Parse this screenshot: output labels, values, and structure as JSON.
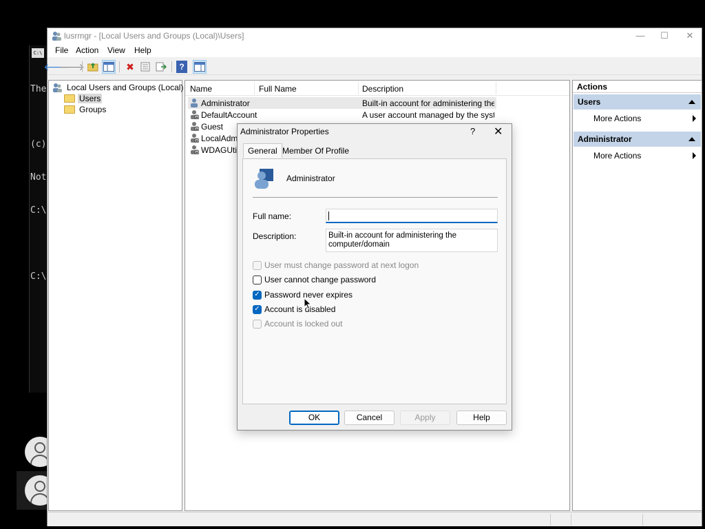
{
  "console": {
    "lines": [
      "The",
      "",
      "(c)",
      "Not",
      "C:\\",
      "",
      "C:\\"
    ],
    "icon_text": "C:\\"
  },
  "window": {
    "title": "lusrmgr - [Local Users and Groups (Local)\\Users]",
    "controls": {
      "minimize": "—",
      "maximize": "☐",
      "close": "✕"
    }
  },
  "menu": {
    "file": "File",
    "action": "Action",
    "view": "View",
    "help": "Help"
  },
  "toolbar": {
    "back_icon": "🡐",
    "forward_icon": "🡒",
    "up_icon": "⬆",
    "delete_icon": "✖",
    "help_icon": "?"
  },
  "tree": {
    "root": "Local Users and Groups (Local)",
    "items": [
      {
        "label": "Users",
        "selected": true
      },
      {
        "label": "Groups",
        "selected": false
      }
    ]
  },
  "list": {
    "columns": [
      "Name",
      "Full Name",
      "Description"
    ],
    "rows": [
      {
        "name": "Administrator",
        "full_name": "",
        "description": "Built-in account for administering the c..."
      },
      {
        "name": "DefaultAccount",
        "full_name": "",
        "description": "A user account managed by the syste..."
      },
      {
        "name": "Guest",
        "full_name": "",
        "description": ""
      },
      {
        "name": "LocalAdmin",
        "full_name": "",
        "description": ""
      },
      {
        "name": "WDAGUtilit",
        "full_name": "",
        "description": ""
      }
    ]
  },
  "actions": {
    "title": "Actions",
    "sections": [
      {
        "header": "Users",
        "items": [
          "More Actions"
        ]
      },
      {
        "header": "Administrator",
        "items": [
          "More Actions"
        ]
      }
    ]
  },
  "dialog": {
    "title": "Administrator Properties",
    "help_glyph": "?",
    "close_glyph": "✕",
    "tabs": [
      "General",
      "Member Of",
      "Profile"
    ],
    "user_name": "Administrator",
    "full_name_label": "Full name:",
    "full_name_value": "",
    "description_label": "Description:",
    "description_line1": "Built-in account for administering the",
    "description_line2": "computer/domain",
    "checkboxes": [
      {
        "label": "User must change password at next logon",
        "checked": false,
        "disabled": true
      },
      {
        "label": "User cannot change password",
        "checked": false,
        "disabled": false
      },
      {
        "label": "Password never expires",
        "checked": true,
        "disabled": false
      },
      {
        "label": "Account is disabled",
        "checked": true,
        "disabled": false
      },
      {
        "label": "Account is locked out",
        "checked": false,
        "disabled": true
      }
    ],
    "buttons": {
      "ok": "OK",
      "cancel": "Cancel",
      "apply": "Apply",
      "help": "Help"
    },
    "check_glyph": "✓"
  },
  "colors": {
    "accent": "#0067c0",
    "action_header": "#c3d4e8"
  }
}
